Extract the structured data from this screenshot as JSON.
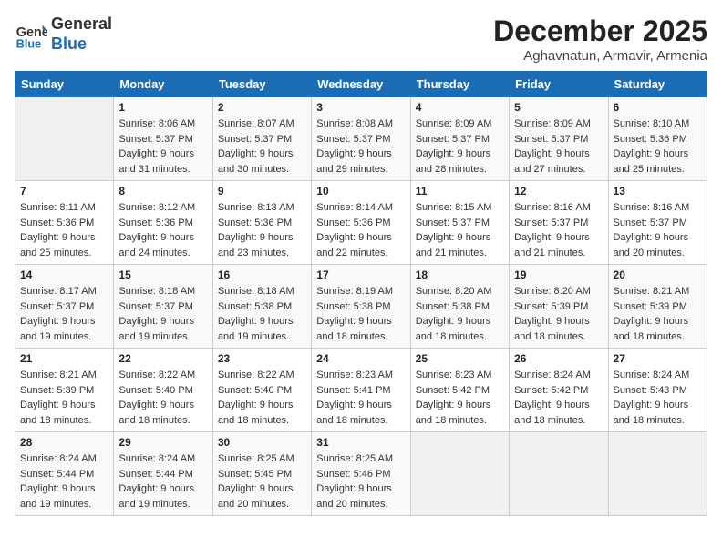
{
  "header": {
    "logo_line1": "General",
    "logo_line2": "Blue",
    "month": "December 2025",
    "location": "Aghavnatun, Armavir, Armenia"
  },
  "days_of_week": [
    "Sunday",
    "Monday",
    "Tuesday",
    "Wednesday",
    "Thursday",
    "Friday",
    "Saturday"
  ],
  "weeks": [
    [
      {
        "day": "",
        "empty": true
      },
      {
        "day": "1",
        "sunrise": "Sunrise: 8:06 AM",
        "sunset": "Sunset: 5:37 PM",
        "daylight": "Daylight: 9 hours and 31 minutes."
      },
      {
        "day": "2",
        "sunrise": "Sunrise: 8:07 AM",
        "sunset": "Sunset: 5:37 PM",
        "daylight": "Daylight: 9 hours and 30 minutes."
      },
      {
        "day": "3",
        "sunrise": "Sunrise: 8:08 AM",
        "sunset": "Sunset: 5:37 PM",
        "daylight": "Daylight: 9 hours and 29 minutes."
      },
      {
        "day": "4",
        "sunrise": "Sunrise: 8:09 AM",
        "sunset": "Sunset: 5:37 PM",
        "daylight": "Daylight: 9 hours and 28 minutes."
      },
      {
        "day": "5",
        "sunrise": "Sunrise: 8:09 AM",
        "sunset": "Sunset: 5:37 PM",
        "daylight": "Daylight: 9 hours and 27 minutes."
      },
      {
        "day": "6",
        "sunrise": "Sunrise: 8:10 AM",
        "sunset": "Sunset: 5:36 PM",
        "daylight": "Daylight: 9 hours and 25 minutes."
      }
    ],
    [
      {
        "day": "7",
        "sunrise": "Sunrise: 8:11 AM",
        "sunset": "Sunset: 5:36 PM",
        "daylight": "Daylight: 9 hours and 25 minutes."
      },
      {
        "day": "8",
        "sunrise": "Sunrise: 8:12 AM",
        "sunset": "Sunset: 5:36 PM",
        "daylight": "Daylight: 9 hours and 24 minutes."
      },
      {
        "day": "9",
        "sunrise": "Sunrise: 8:13 AM",
        "sunset": "Sunset: 5:36 PM",
        "daylight": "Daylight: 9 hours and 23 minutes."
      },
      {
        "day": "10",
        "sunrise": "Sunrise: 8:14 AM",
        "sunset": "Sunset: 5:36 PM",
        "daylight": "Daylight: 9 hours and 22 minutes."
      },
      {
        "day": "11",
        "sunrise": "Sunrise: 8:15 AM",
        "sunset": "Sunset: 5:37 PM",
        "daylight": "Daylight: 9 hours and 21 minutes."
      },
      {
        "day": "12",
        "sunrise": "Sunrise: 8:16 AM",
        "sunset": "Sunset: 5:37 PM",
        "daylight": "Daylight: 9 hours and 21 minutes."
      },
      {
        "day": "13",
        "sunrise": "Sunrise: 8:16 AM",
        "sunset": "Sunset: 5:37 PM",
        "daylight": "Daylight: 9 hours and 20 minutes."
      }
    ],
    [
      {
        "day": "14",
        "sunrise": "Sunrise: 8:17 AM",
        "sunset": "Sunset: 5:37 PM",
        "daylight": "Daylight: 9 hours and 19 minutes."
      },
      {
        "day": "15",
        "sunrise": "Sunrise: 8:18 AM",
        "sunset": "Sunset: 5:37 PM",
        "daylight": "Daylight: 9 hours and 19 minutes."
      },
      {
        "day": "16",
        "sunrise": "Sunrise: 8:18 AM",
        "sunset": "Sunset: 5:38 PM",
        "daylight": "Daylight: 9 hours and 19 minutes."
      },
      {
        "day": "17",
        "sunrise": "Sunrise: 8:19 AM",
        "sunset": "Sunset: 5:38 PM",
        "daylight": "Daylight: 9 hours and 18 minutes."
      },
      {
        "day": "18",
        "sunrise": "Sunrise: 8:20 AM",
        "sunset": "Sunset: 5:38 PM",
        "daylight": "Daylight: 9 hours and 18 minutes."
      },
      {
        "day": "19",
        "sunrise": "Sunrise: 8:20 AM",
        "sunset": "Sunset: 5:39 PM",
        "daylight": "Daylight: 9 hours and 18 minutes."
      },
      {
        "day": "20",
        "sunrise": "Sunrise: 8:21 AM",
        "sunset": "Sunset: 5:39 PM",
        "daylight": "Daylight: 9 hours and 18 minutes."
      }
    ],
    [
      {
        "day": "21",
        "sunrise": "Sunrise: 8:21 AM",
        "sunset": "Sunset: 5:39 PM",
        "daylight": "Daylight: 9 hours and 18 minutes."
      },
      {
        "day": "22",
        "sunrise": "Sunrise: 8:22 AM",
        "sunset": "Sunset: 5:40 PM",
        "daylight": "Daylight: 9 hours and 18 minutes."
      },
      {
        "day": "23",
        "sunrise": "Sunrise: 8:22 AM",
        "sunset": "Sunset: 5:40 PM",
        "daylight": "Daylight: 9 hours and 18 minutes."
      },
      {
        "day": "24",
        "sunrise": "Sunrise: 8:23 AM",
        "sunset": "Sunset: 5:41 PM",
        "daylight": "Daylight: 9 hours and 18 minutes."
      },
      {
        "day": "25",
        "sunrise": "Sunrise: 8:23 AM",
        "sunset": "Sunset: 5:42 PM",
        "daylight": "Daylight: 9 hours and 18 minutes."
      },
      {
        "day": "26",
        "sunrise": "Sunrise: 8:24 AM",
        "sunset": "Sunset: 5:42 PM",
        "daylight": "Daylight: 9 hours and 18 minutes."
      },
      {
        "day": "27",
        "sunrise": "Sunrise: 8:24 AM",
        "sunset": "Sunset: 5:43 PM",
        "daylight": "Daylight: 9 hours and 18 minutes."
      }
    ],
    [
      {
        "day": "28",
        "sunrise": "Sunrise: 8:24 AM",
        "sunset": "Sunset: 5:44 PM",
        "daylight": "Daylight: 9 hours and 19 minutes."
      },
      {
        "day": "29",
        "sunrise": "Sunrise: 8:24 AM",
        "sunset": "Sunset: 5:44 PM",
        "daylight": "Daylight: 9 hours and 19 minutes."
      },
      {
        "day": "30",
        "sunrise": "Sunrise: 8:25 AM",
        "sunset": "Sunset: 5:45 PM",
        "daylight": "Daylight: 9 hours and 20 minutes."
      },
      {
        "day": "31",
        "sunrise": "Sunrise: 8:25 AM",
        "sunset": "Sunset: 5:46 PM",
        "daylight": "Daylight: 9 hours and 20 minutes."
      },
      {
        "day": "",
        "empty": true
      },
      {
        "day": "",
        "empty": true
      },
      {
        "day": "",
        "empty": true
      }
    ]
  ]
}
